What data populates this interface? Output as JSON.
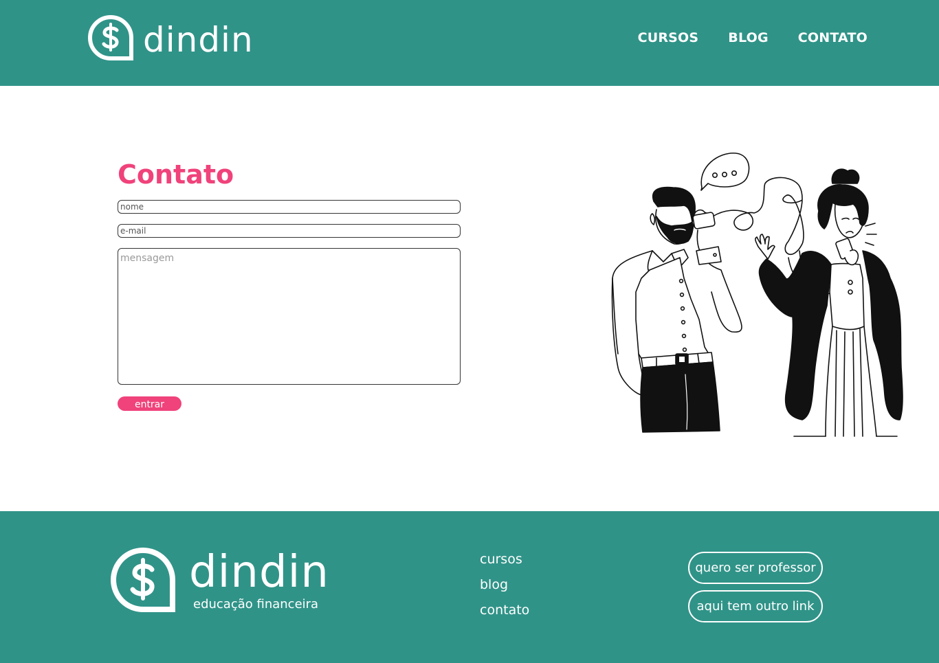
{
  "header": {
    "logo_text": "dindin",
    "nav": [
      "CURSOS",
      "BLOG",
      "CONTATO"
    ]
  },
  "contact": {
    "title": "Contato",
    "name_placeholder": "nome",
    "email_placeholder": "e-mail",
    "message_placeholder": "mensagem",
    "submit_label": "entrar"
  },
  "footer": {
    "logo_text": "dindin",
    "tagline": "educação financeira",
    "links": [
      "cursos",
      "blog",
      "contato"
    ],
    "buttons": [
      "quero ser professor",
      "aqui tem outro link"
    ]
  },
  "colors": {
    "brand_teal": "#309388",
    "accent_pink": "#f0427b"
  },
  "icons": {
    "logo": "dollar-speech-bubble-icon",
    "illustration": "two-people-tin-can-phone"
  }
}
